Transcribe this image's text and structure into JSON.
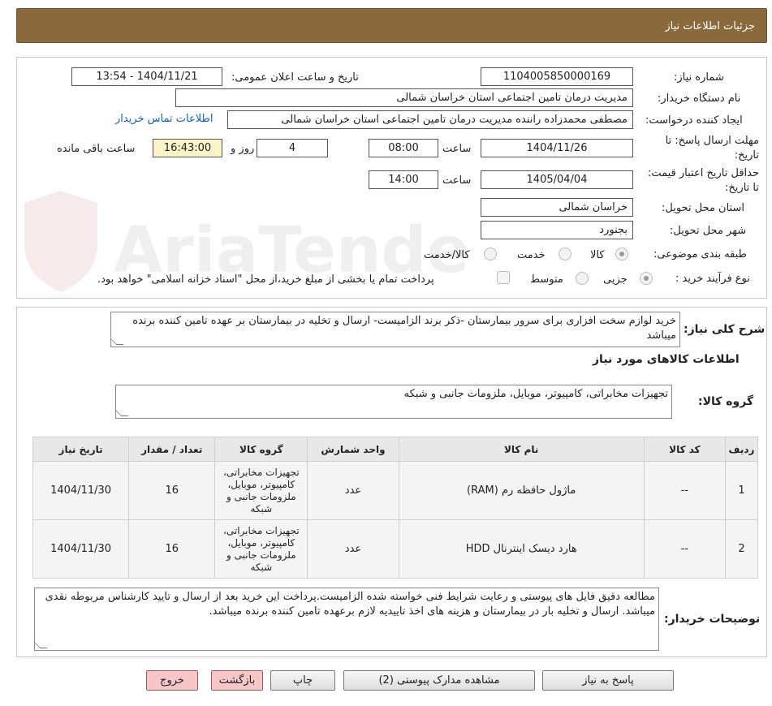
{
  "title": "جزئیات اطلاعات نیاز",
  "watermark": "AriaTender.neT",
  "fields": {
    "need_number_label": "شماره نیاز:",
    "need_number": "1104005850000169",
    "announce_label": "تاریخ و ساعت اعلان عمومی:",
    "announce_value": "1404/11/21 - 13:54",
    "buyer_org_label": "نام دستگاه خریدار:",
    "buyer_org": "مدیریت درمان تامین اجتماعی استان خراسان شمالی",
    "creator_label": "ایجاد کننده درخواست:",
    "creator": "مصطفی محمدزاده راننده مدیریت درمان تامین اجتماعی استان خراسان شمالی",
    "contact_link": "اطلاعات تماس خریدار",
    "deadline_label": "مهلت ارسال پاسخ: تا تاریخ:",
    "deadline_date": "1404/11/26",
    "time_label": "ساعت",
    "deadline_time": "08:00",
    "days": "4",
    "days_label": "روز و",
    "remaining_time": "16:43:00",
    "remaining_label": "ساعت باقی مانده",
    "validity_label": "حداقل تاریخ اعتبار قیمت: تا تاریخ:",
    "validity_date": "1405/04/04",
    "validity_time": "14:00",
    "province_label": "استان محل تحویل:",
    "province": "خراسان شمالی",
    "city_label": "شهر محل تحویل:",
    "city": "بجنورد",
    "category_label": "طبقه بندی موضوعی:",
    "category_options": [
      "کالا",
      "خدمت",
      "کالا/خدمت"
    ],
    "category_selected": "کالا",
    "process_label": "نوع فرآیند خرید :",
    "process_options": [
      "جزیی",
      "متوسط"
    ],
    "process_selected": "جزیی",
    "treasury_note": "پرداخت تمام یا بخشی از مبلغ خرید،از محل \"اسناد خزانه اسلامی\" خواهد بود."
  },
  "description": {
    "label": "شرح کلی نیاز:",
    "text": "خرید لوازم سخت افزاری برای سرور بیمارستان -ذکر برند الزامیست- ارسال و تخلیه در بیمارستان بر عهده تامین کننده برنده میباشد"
  },
  "goods_section": {
    "title": "اطلاعات کالاهای مورد نیاز",
    "group_label": "گروه کالا:",
    "group_value": "تجهیزات مخابراتی، کامپیوتر، موبایل، ملزومات جانبی و شبکه"
  },
  "table": {
    "headers": [
      "ردیف",
      "کد کالا",
      "نام کالا",
      "واحد شمارش",
      "گروه کالا",
      "تعداد / مقدار",
      "تاریخ نیاز"
    ],
    "rows": [
      [
        "1",
        "--",
        "ماژول حافظه رم (RAM)",
        "عدد",
        "تجهیزات مخابراتی، کامپیوتر، موبایل، ملزومات جانبی و شبکه",
        "16",
        "1404/11/30"
      ],
      [
        "2",
        "--",
        "هارد دیسک اینترنال HDD",
        "عدد",
        "تجهیزات مخابراتی، کامپیوتر، موبایل، ملزومات جانبی و شبکه",
        "16",
        "1404/11/30"
      ]
    ]
  },
  "buyer_notes": {
    "label": "توضیحات خریدار:",
    "text": "مطالعه دقیق فایل های پیوستی و رعایت شرایط فنی خواسته شده الزامیست.پرداخت این خرید بعد از ارسال و تایید کارشناس مربوطه نقدی میباشد. ارسال و تخلیه بار در بیمارستان و هزینه های اخذ تاییدیه لازم برعهده تامین کننده برنده میباشد."
  },
  "buttons": {
    "reply": "پاسخ به نیاز",
    "attachments": "مشاهده مدارک پیوستی (2)",
    "print": "چاپ",
    "back": "بازگشت",
    "exit": "خروج"
  },
  "colors": {
    "header_bg": "#8a6a3c",
    "link": "#1a5fb4",
    "highlight_field": "#fbf4c8",
    "exit_button": "#f7c6c6"
  }
}
